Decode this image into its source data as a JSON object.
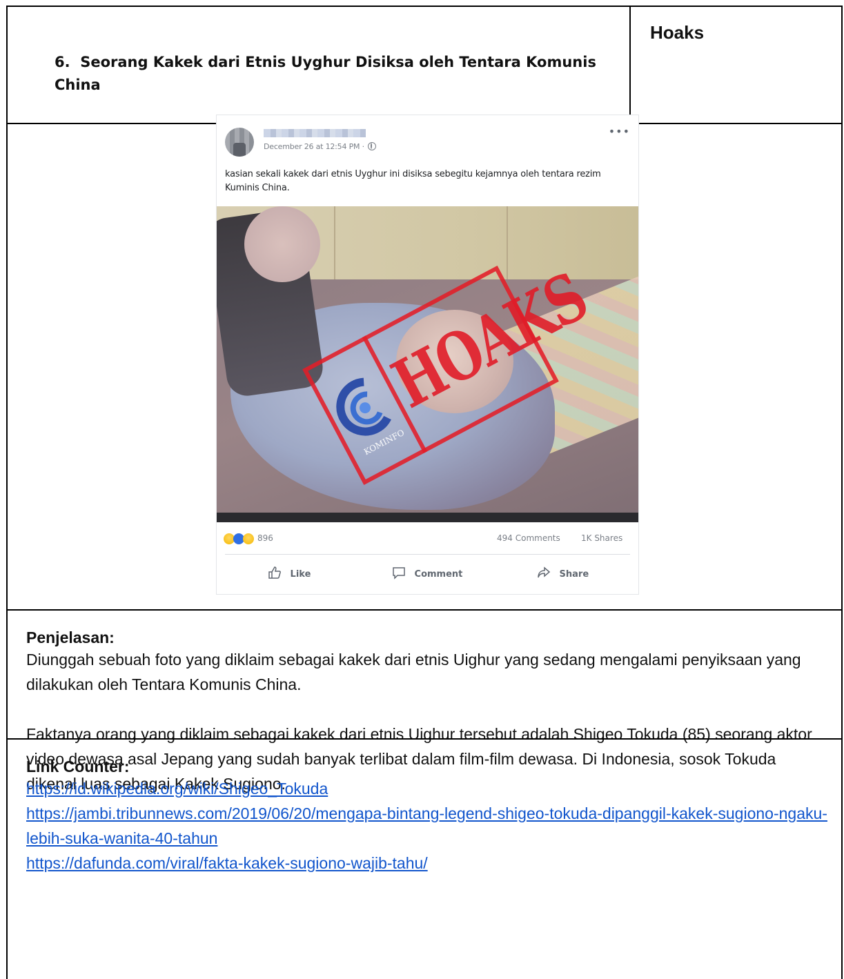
{
  "item": {
    "number": "6.",
    "title": "Seorang Kakek dari Etnis Uyghur Disiksa oleh Tentara Komunis China",
    "status": "Hoaks"
  },
  "post": {
    "timestamp": "December 26 at 12:54 PM ·",
    "text": "kasian sekali kakek dari etnis Uyghur ini disiksa sebegitu kejamnya oleh tentara rezim Kuminis China.",
    "stamp_text": "HOAKS",
    "stamp_logo_text": "KOMINFO",
    "reaction_count": "896",
    "comments": "494 Comments",
    "shares": "1K Shares",
    "actions": {
      "like": "Like",
      "comment": "Comment",
      "share": "Share"
    }
  },
  "explanation": {
    "heading": "Penjelasan:",
    "paragraph1": "Diunggah sebuah foto yang diklaim sebagai kakek dari etnis Uighur yang sedang mengalami penyiksaan yang dilakukan oleh Tentara Komunis China.",
    "paragraph2": "Faktanya orang yang diklaim sebagai kakek dari etnis Uighur tersebut adalah Shigeo Tokuda (85) seorang aktor video dewasa asal Jepang yang sudah banyak terlibat dalam film-film dewasa. Di Indonesia, sosok Tokuda dikenal luas sebagai Kakek Sugiono."
  },
  "links": {
    "heading": "Link Counter:",
    "items": [
      "https://id.wikipedia.org/wiki/Shigeo_Tokuda",
      "https://jambi.tribunnews.com/2019/06/20/mengapa-bintang-legend-shigeo-tokuda-dipanggil-kakek-sugiono-ngaku-lebih-suka-wanita-40-tahun",
      "https://dafunda.com/viral/fakta-kakek-sugiono-wajib-tahu/"
    ]
  }
}
